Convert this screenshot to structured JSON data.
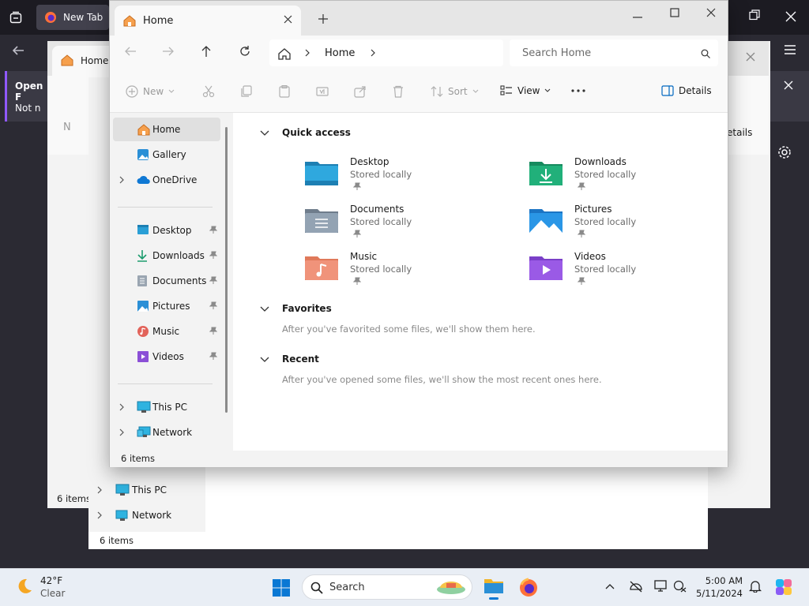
{
  "firefox": {
    "tab_label": "New Tab",
    "notice_title": "Open F",
    "notice_button": "Not n"
  },
  "bg_window_1": {
    "tab_label": "Home",
    "details_label": "etails",
    "toolbar_new": "N",
    "status": "6 items"
  },
  "bg_window_2": {
    "this_pc": "This PC",
    "network": "Network",
    "status": "6 items"
  },
  "window": {
    "tab_label": "Home",
    "breadcrumb": "Home",
    "search_placeholder": "Search Home",
    "toolbar": {
      "new": "New",
      "sort": "Sort",
      "view": "View",
      "details": "Details"
    },
    "sidebar": {
      "home": "Home",
      "gallery": "Gallery",
      "onedrive": "OneDrive",
      "desktop": "Desktop",
      "downloads": "Downloads",
      "documents": "Documents",
      "pictures": "Pictures",
      "music": "Music",
      "videos": "Videos",
      "this_pc": "This PC",
      "network": "Network"
    },
    "quick_access": {
      "title": "Quick access",
      "items": [
        {
          "name": "Desktop",
          "sub": "Stored locally"
        },
        {
          "name": "Downloads",
          "sub": "Stored locally"
        },
        {
          "name": "Documents",
          "sub": "Stored locally"
        },
        {
          "name": "Pictures",
          "sub": "Stored locally"
        },
        {
          "name": "Music",
          "sub": "Stored locally"
        },
        {
          "name": "Videos",
          "sub": "Stored locally"
        }
      ]
    },
    "favorites": {
      "title": "Favorites",
      "empty": "After you've favorited some files, we'll show them here."
    },
    "recent": {
      "title": "Recent",
      "empty": "After you've opened some files, we'll show the most recent ones here."
    },
    "status": "6 items"
  },
  "taskbar": {
    "weather_temp": "42°F",
    "weather_cond": "Clear",
    "search_label": "Search",
    "time": "5:00 AM",
    "date": "5/11/2024"
  },
  "colors": {
    "accent": "#0067c0",
    "firefox_bg": "#1c1b22",
    "folder_blue": "#2a9fd6"
  }
}
